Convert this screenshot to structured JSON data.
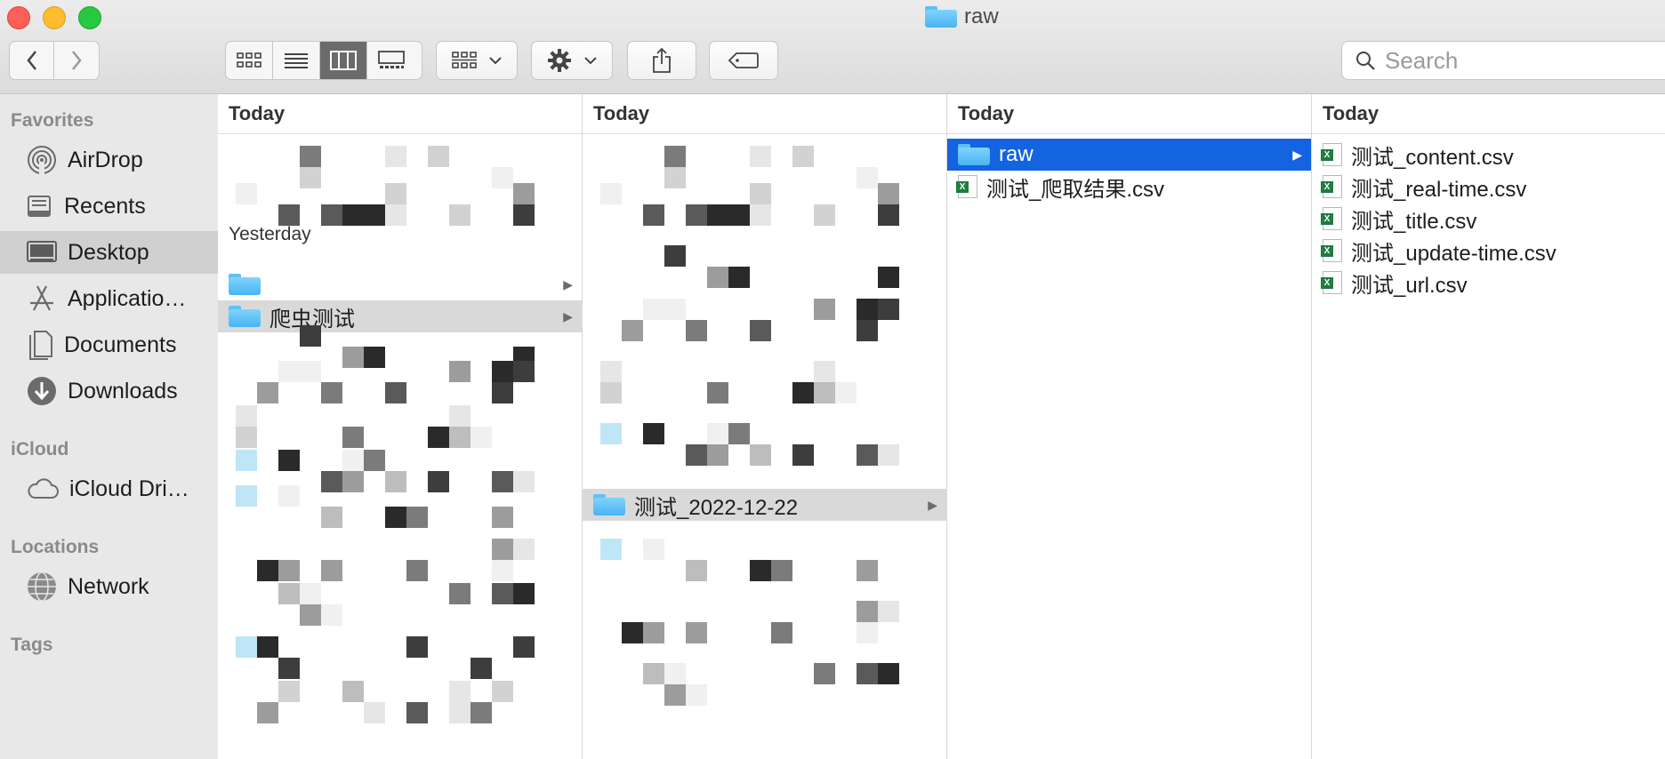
{
  "window": {
    "title": "raw"
  },
  "toolbar": {
    "search_placeholder": "Search",
    "icons": [
      "chevron-left-icon",
      "chevron-right-icon",
      "icon-view-icon",
      "list-view-icon",
      "column-view-icon",
      "gallery-view-icon",
      "group-icon",
      "gear-icon",
      "share-icon",
      "tag-icon",
      "search-icon"
    ]
  },
  "sidebar": {
    "sections": {
      "favorites": "Favorites",
      "icloud": "iCloud",
      "locations": "Locations",
      "tags": "Tags"
    },
    "items": [
      {
        "label": "AirDrop",
        "icon": "airdrop-icon"
      },
      {
        "label": "Recents",
        "icon": "recents-icon"
      },
      {
        "label": "Desktop",
        "icon": "desktop-icon",
        "selected": true
      },
      {
        "label": "Applicatio…",
        "icon": "applications-icon"
      },
      {
        "label": "Documents",
        "icon": "documents-icon"
      },
      {
        "label": "Downloads",
        "icon": "downloads-icon"
      },
      {
        "label": "iCloud Dri…",
        "icon": "cloud-icon"
      },
      {
        "label": "Network",
        "icon": "network-icon"
      }
    ]
  },
  "columns": [
    {
      "header": "Today",
      "group": "Yesterday",
      "folder": "爬虫测试"
    },
    {
      "header": "Today",
      "folder": "测试_2022-12-22"
    },
    {
      "header": "Today",
      "items": [
        {
          "name": "raw",
          "type": "folder",
          "selected": true
        },
        {
          "name": "测试_爬取结果.csv",
          "type": "csv"
        }
      ]
    },
    {
      "header": "Today",
      "files": [
        "测试_content.csv",
        "测试_real-time.csv",
        "测试_title.csv",
        "测试_update-time.csv",
        "测试_url.csv"
      ]
    }
  ],
  "colors": {
    "selection": "#1463e0",
    "sidebar_bg": "#e8e8e8",
    "highlight_gray": "#d9d9d9"
  }
}
